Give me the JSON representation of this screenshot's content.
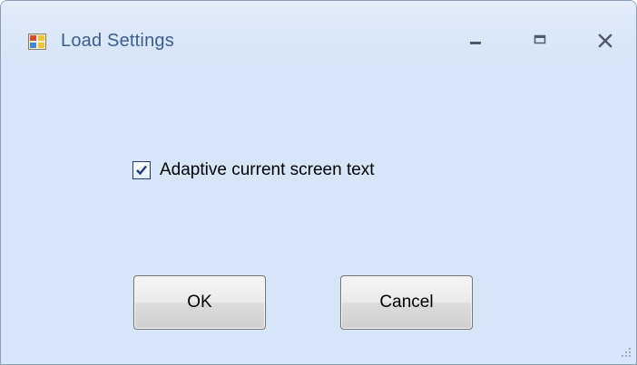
{
  "window": {
    "title": "Load Settings",
    "app_icon": "window-app-icon",
    "controls": {
      "minimize_icon": "minimize-icon",
      "maximize_icon": "maximize-icon",
      "close_icon": "close-icon"
    }
  },
  "options": {
    "adaptive_text": {
      "label": "Adaptive current screen text",
      "checked": true
    }
  },
  "buttons": {
    "ok_label": "OK",
    "cancel_label": "Cancel"
  },
  "colors": {
    "background": "#d6e5f7",
    "title_text": "#3b5d92",
    "checkmark": "#1c3c78"
  }
}
